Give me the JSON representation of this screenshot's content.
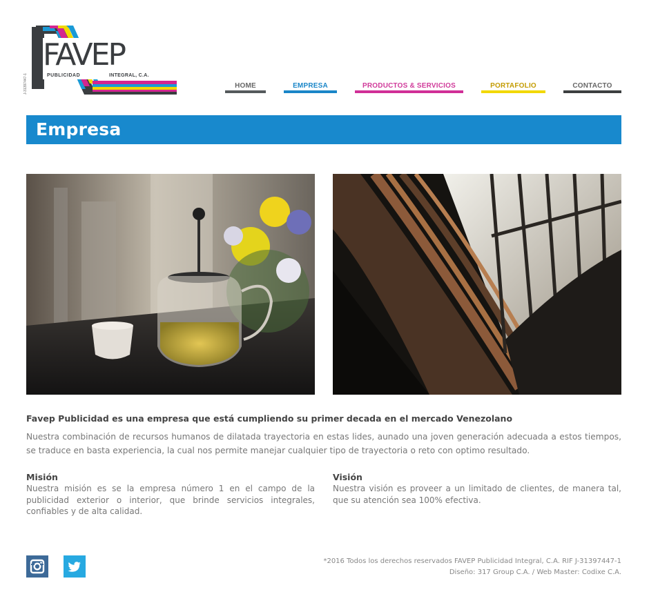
{
  "logo": {
    "main": "FAVEP",
    "sub_left": "PUBLICIDAD",
    "sub_right": "INTEGRAL, C.A.",
    "rif": "J-31397447-1"
  },
  "nav": {
    "items": [
      {
        "label": "HOME",
        "color": "#555a5c"
      },
      {
        "label": "EMPRESA",
        "color": "#1a86c8"
      },
      {
        "label": "PRODUCTOS & SERVICIOS",
        "color": "#d02f97"
      },
      {
        "label": "PORTAFOLIO",
        "color": "#f2d800"
      },
      {
        "label": "CONTACTO",
        "color": "#3c3f40"
      }
    ]
  },
  "banner": {
    "title": "Empresa",
    "color": "#1889cd"
  },
  "intro": {
    "title": "Favep Publicidad es una empresa que está cumpliendo su primer decada en el mercado Venezolano",
    "text": "Nuestra combinación de recursos humanos de dilatada trayectoria en estas lides, aunado una joven generación adecuada a estos tiempos, se traduce en basta experiencia, la cual nos permite manejar cualquier tipo de trayectoria o reto con optimo resultado."
  },
  "mision": {
    "title": "Misión",
    "text": "Nuestra misión es se la empresa número 1 en el campo de la publicidad exterior o interior, que brinde servicios integrales, confiables y de alta calidad."
  },
  "vision": {
    "title": "Visión",
    "text": "Nuestra visión es proveer a un limitado de clientes, de manera tal, que su atención sea 100% efectiva."
  },
  "footer": {
    "social": [
      {
        "name": "instagram-icon",
        "color": "#3d6a98"
      },
      {
        "name": "twitter-icon",
        "color": "#27a9e1"
      }
    ],
    "line1": "*2016 Todos los derechos reservados FAVEP Publicidad Integral, C.A. RIF J-31397447-1",
    "line2": "Diseño: 317 Group C.A. / Web Master: Codixe C.A."
  }
}
